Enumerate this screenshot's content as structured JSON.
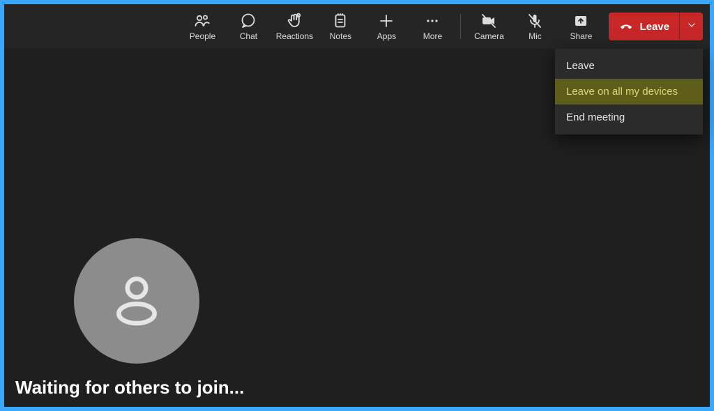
{
  "toolbar": {
    "people": "People",
    "chat": "Chat",
    "reactions": "Reactions",
    "notes": "Notes",
    "apps": "Apps",
    "more": "More",
    "camera": "Camera",
    "mic": "Mic",
    "share": "Share",
    "leave": "Leave"
  },
  "menu": {
    "items": [
      {
        "label": "Leave",
        "highlight": false
      },
      {
        "label": "Leave on all my devices",
        "highlight": true
      },
      {
        "label": "End meeting",
        "highlight": false
      }
    ]
  },
  "main": {
    "waiting_text": "Waiting for others to join..."
  },
  "colors": {
    "leave_button": "#c72727",
    "menu_highlight_bg": "#5e5e1a",
    "frame_border": "#3aa7ff"
  }
}
